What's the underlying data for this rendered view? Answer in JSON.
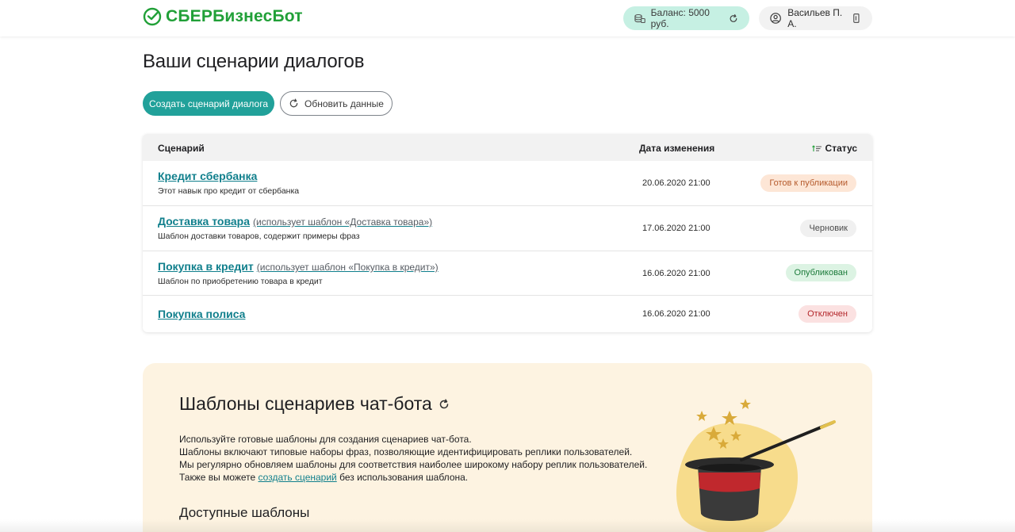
{
  "header": {
    "logo_text": "СБЕРБизнесБот",
    "balance_label": "Баланс: 5000 руб.",
    "user_name": "Васильев П. А."
  },
  "page": {
    "title": "Ваши сценарии диалогов"
  },
  "actions": {
    "create_label": "Создать сценарий диалога",
    "refresh_label": "Обновить данные"
  },
  "table": {
    "columns": {
      "scenario": "Сценарий",
      "date": "Дата изменения",
      "status": "Статус"
    },
    "rows": [
      {
        "name": "Кредит сбербанка",
        "note": "",
        "description": "Этот навык про кредит от сбербанка",
        "date": "20.06.2020 21:00",
        "status": "Готов к публикации",
        "status_bg": "#fde6d6",
        "status_color": "#b55a2c"
      },
      {
        "name": "Доставка товара",
        "note": "(использует шаблон «Доставка товара»)",
        "description": "Шаблон доставки товаров, содержит примеры фраз",
        "date": "17.06.2020 21:00",
        "status": "Черновик",
        "status_bg": "#f0f0f0",
        "status_color": "#4a4a4a"
      },
      {
        "name": "Покупка в кредит",
        "note": "(использует шаблон «Покупка в кредит»)",
        "description": "Шаблон по приобретению товара в кредит",
        "date": "16.06.2020 21:00",
        "status": "Опубликован",
        "status_bg": "#dcf3e3",
        "status_color": "#1b7a3a"
      },
      {
        "name": "Покупка полиса",
        "note": "",
        "description": "",
        "date": "16.06.2020 21:00",
        "status": "Отключен",
        "status_bg": "#fbe1e1",
        "status_color": "#b3262a"
      }
    ]
  },
  "templates": {
    "title": "Шаблоны сценариев чат-бота",
    "line1": "Используйте готовые шаблоны для создания сценариев чат-бота.",
    "line2": "Шаблоны включают типовые наборы фраз, позволяющие идентифицировать реплики пользователей.",
    "line3": "Мы регулярно обновляем шаблоны для соответствия наиболее широкому набору реплик пользователей.",
    "line4_before": "Также вы можете ",
    "line4_link": "создать сценарий",
    "line4_after": " без использования шаблона.",
    "available_title": "Доступные шаблоны"
  },
  "colors": {
    "brand_green": "#21a038",
    "primary_button": "#21a19a",
    "link": "#107f8c",
    "balance_bg": "#c6f0e3",
    "templates_bg": "#fdf3e1"
  }
}
